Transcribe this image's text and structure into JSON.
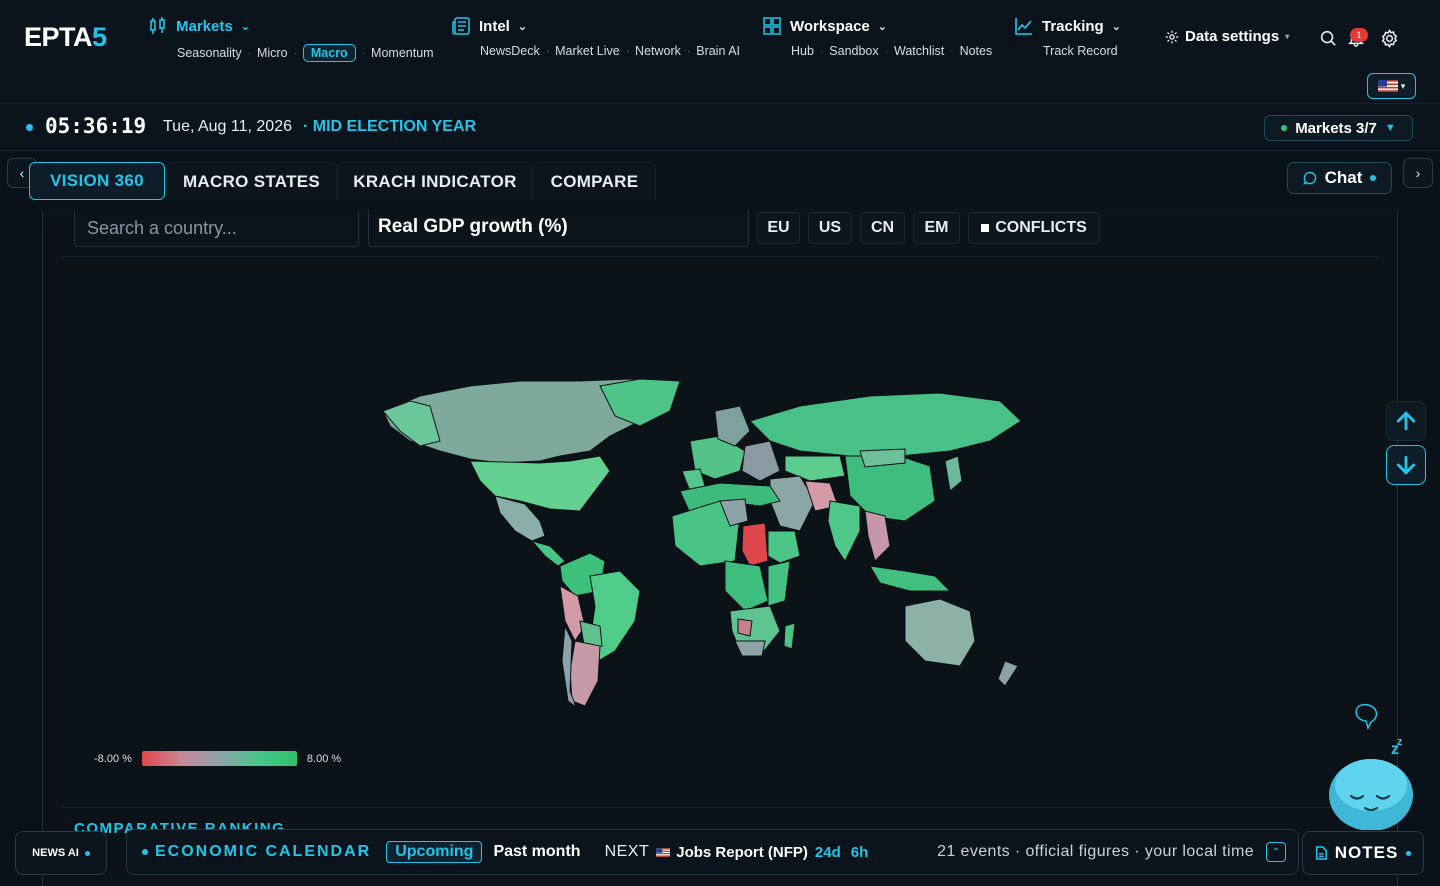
{
  "brand": {
    "logo_main": "EPTA",
    "logo_accent": "5"
  },
  "nav": {
    "markets": {
      "label": "Markets",
      "items": [
        "Seasonality",
        "Micro",
        "Macro",
        "Momentum"
      ],
      "active": "Macro"
    },
    "intel": {
      "label": "Intel",
      "items": [
        "NewsDeck",
        "Market Live",
        "Network",
        "Brain AI"
      ]
    },
    "workspace": {
      "label": "Workspace",
      "items": [
        "Hub",
        "Sandbox",
        "Watchlist",
        "Notes"
      ]
    },
    "tracking": {
      "label": "Tracking",
      "items": [
        "Track Record"
      ]
    },
    "data_settings": "Data settings",
    "notification_count": "1"
  },
  "status": {
    "clock": "05:36:19",
    "date": "Tue, Aug 11, 2026",
    "cycle": "MID ELECTION YEAR",
    "markets_button": "Markets 3/7"
  },
  "tabs": [
    "VISION 360",
    "MACRO STATES",
    "KRACH INDICATOR",
    "COMPARE"
  ],
  "active_tab": "VISION 360",
  "chat_label": "Chat",
  "map_controls": {
    "search_placeholder": "Search a country...",
    "indicator": "Real GDP growth (%)",
    "regions": [
      "EU",
      "US",
      "CN",
      "EM"
    ],
    "conflicts_label": "CONFLICTS"
  },
  "legend": {
    "min": "-8.00 %",
    "max": "8.00 %",
    "colors": [
      "#e0474c",
      "#8ea3a8",
      "#2fbf6a"
    ]
  },
  "section_title": "COMPARATIVE RANKING",
  "bottom_bar": {
    "news_ai": "NEWS AI",
    "calendar_title": "ECONOMIC CALENDAR",
    "filter_upcoming": "Upcoming",
    "filter_past": "Past month",
    "next_label": "NEXT",
    "next_event": "Jobs Report (NFP)",
    "countdown_days": "24d",
    "countdown_hours": "6h",
    "summary": "21 events · official figures · your local time",
    "notes": "NOTES"
  },
  "colors": {
    "accent": "#22c5e8",
    "background": "#0a1219",
    "positive": "#2fbf6a",
    "negative": "#e0474c"
  }
}
